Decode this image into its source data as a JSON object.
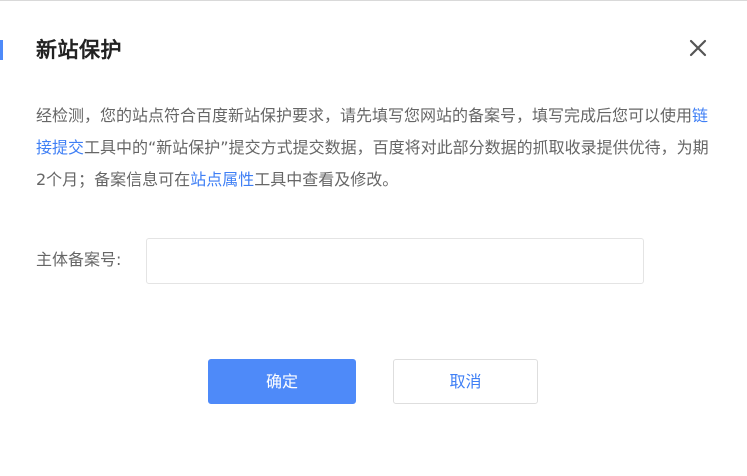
{
  "dialog": {
    "title": "新站保护",
    "description": {
      "part1": "经检测，您的站点符合百度新站保护要求，请先填写您网站的备案号，填写完成后您可以使用",
      "link1": "链接提交",
      "part2": "工具中的“新站保护”提交方式提交数据，百度将对此部分数据的抓取收录提供优待，为期2个月；备案信息可在",
      "link2": "站点属性",
      "part3": "工具中查看及修改。"
    },
    "form": {
      "label": "主体备案号:",
      "value": "",
      "placeholder": ""
    },
    "buttons": {
      "confirm": "确定",
      "cancel": "取消"
    },
    "close_icon": "close-icon"
  },
  "colors": {
    "accent": "#4e8af9",
    "link": "#3f7ff5",
    "text": "#666666",
    "title": "#222222"
  }
}
